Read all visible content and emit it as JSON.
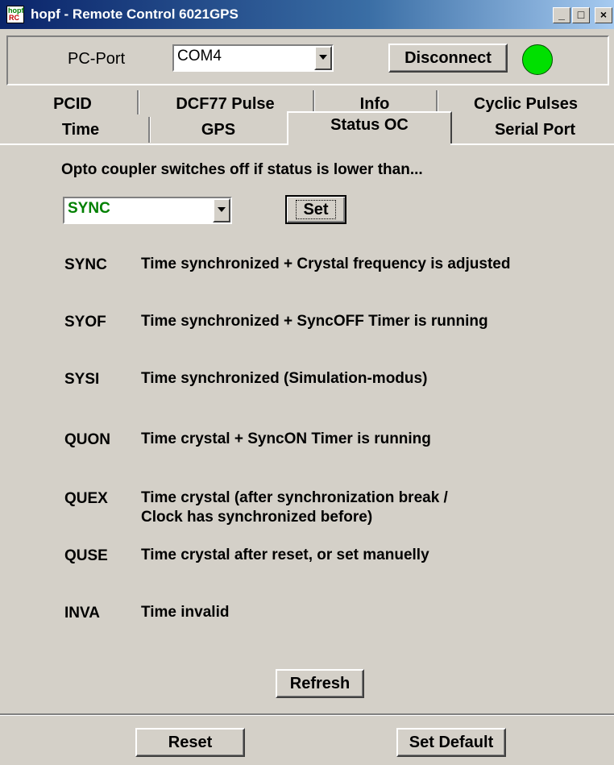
{
  "window": {
    "title": "hopf - Remote Control 6021GPS",
    "icon_text_top": "hopf",
    "icon_text_bottom": "RC",
    "min_glyph": "_",
    "max_glyph": "□",
    "close_glyph": "×"
  },
  "port": {
    "label": "PC-Port",
    "selected": "COM4",
    "disconnect_label": "Disconnect",
    "status_color": "#00e000"
  },
  "tabs": {
    "row1": [
      "PCID",
      "DCF77 Pulse",
      "Info",
      "Cyclic Pulses"
    ],
    "row2": [
      "Time",
      "GPS",
      "Status OC",
      "Serial Port"
    ],
    "active": "Status OC"
  },
  "status_oc": {
    "intro": "Opto coupler switches off if status is lower than...",
    "selected": "SYNC",
    "set_label": "Set",
    "items": [
      {
        "code": "SYNC",
        "desc": "Time synchronized + Crystal frequency is adjusted"
      },
      {
        "code": "SYOF",
        "desc": "Time synchronized + SyncOFF Timer is running"
      },
      {
        "code": "SYSI",
        "desc": "Time synchronized (Simulation-modus)"
      },
      {
        "code": "QUON",
        "desc": "Time crystal + SyncON Timer is running"
      },
      {
        "code": "QUEX",
        "desc": "Time crystal (after synchronization break /",
        "desc2": "Clock has synchronized before)"
      },
      {
        "code": "QUSE",
        "desc": "Time crystal after reset, or set manuelly"
      },
      {
        "code": "INVA",
        "desc": "Time invalid"
      }
    ],
    "refresh_label": "Refresh"
  },
  "footer": {
    "reset_label": "Reset",
    "set_default_label": "Set Default"
  }
}
